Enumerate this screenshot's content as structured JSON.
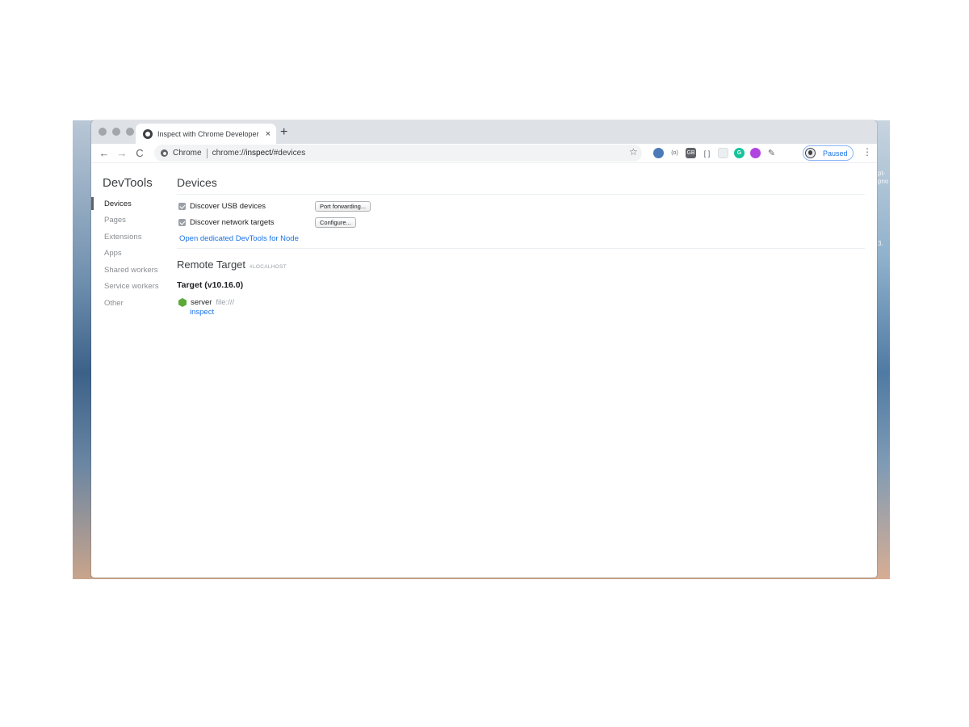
{
  "desktop": {
    "edge_text": [
      "pt-",
      "pno",
      "3."
    ]
  },
  "browser": {
    "tab": {
      "title": "Inspect with Chrome Developer Tools",
      "close": "×"
    },
    "new_tab": "+",
    "nav": {
      "back": "←",
      "forward": "→",
      "reload": "C"
    },
    "omnibox": {
      "chip": "Chrome",
      "url_scheme": "chrome://",
      "url_host": "inspect",
      "url_rest": "/#devices"
    },
    "bookmark_star": "☆",
    "extensions": [
      {
        "icon": "cloud-extension-icon",
        "color": "#4c79b8",
        "glyph": ""
      },
      {
        "icon": "code-brackets-extension-icon",
        "color": "#ffffff",
        "glyph": "(o)"
      },
      {
        "icon": "grid-extension-icon",
        "color": "#5f6368",
        "glyph": "GB"
      },
      {
        "icon": "selection-extension-icon",
        "color": "#ffffff",
        "glyph": "[ ]"
      },
      {
        "icon": "blank-extension-icon",
        "color": "#eceff1",
        "glyph": ""
      },
      {
        "icon": "grammarly-extension-icon",
        "color": "#15c39a",
        "glyph": "G"
      },
      {
        "icon": "purple-circle-extension-icon",
        "color": "#b044e0",
        "glyph": ""
      },
      {
        "icon": "eyedropper-extension-icon",
        "color": "#5f6368",
        "glyph": ""
      }
    ],
    "profile": {
      "label": "Paused",
      "accent": "#1a73e8"
    },
    "menu": "⋮"
  },
  "devtools": {
    "title": "DevTools",
    "sidebar": [
      {
        "label": "Devices",
        "selected": true
      },
      {
        "label": "Pages"
      },
      {
        "label": "Extensions"
      },
      {
        "label": "Apps"
      },
      {
        "label": "Shared workers"
      },
      {
        "label": "Service workers"
      },
      {
        "label": "Other"
      }
    ],
    "main": {
      "heading": "Devices",
      "options": [
        {
          "label": "Discover USB devices",
          "checked": true,
          "button": "Port forwarding..."
        },
        {
          "label": "Discover network targets",
          "checked": true,
          "button": "Configure..."
        }
      ],
      "node_link": "Open dedicated DevTools for Node",
      "remote_target": {
        "title": "Remote Target",
        "tag": "#LOCALHOST"
      },
      "target": {
        "title": "Target (v10.16.0)",
        "entry": {
          "name": "server",
          "url": "file:///",
          "action": "inspect"
        }
      }
    }
  }
}
